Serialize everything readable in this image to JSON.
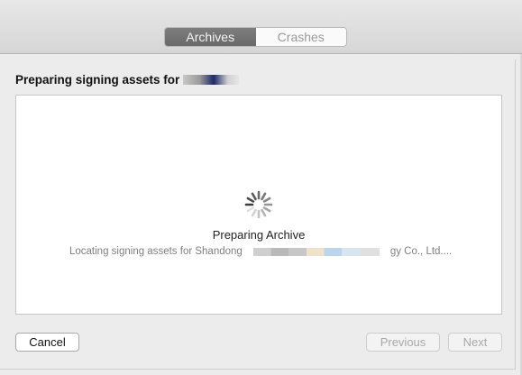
{
  "toolbar": {
    "tabs": [
      {
        "label": "Archives",
        "active": true
      },
      {
        "label": "Crashes",
        "active": false
      }
    ]
  },
  "sheet": {
    "title": "Preparing signing assets for",
    "status_title": "Preparing Archive",
    "status_detail_prefix": "Locating signing assets for Shandong",
    "status_detail_suffix": "gy Co., Ltd...."
  },
  "buttons": {
    "cancel": "Cancel",
    "previous": "Previous",
    "next": "Next"
  },
  "icons": {
    "spinner": "progress-spinner-icon"
  }
}
